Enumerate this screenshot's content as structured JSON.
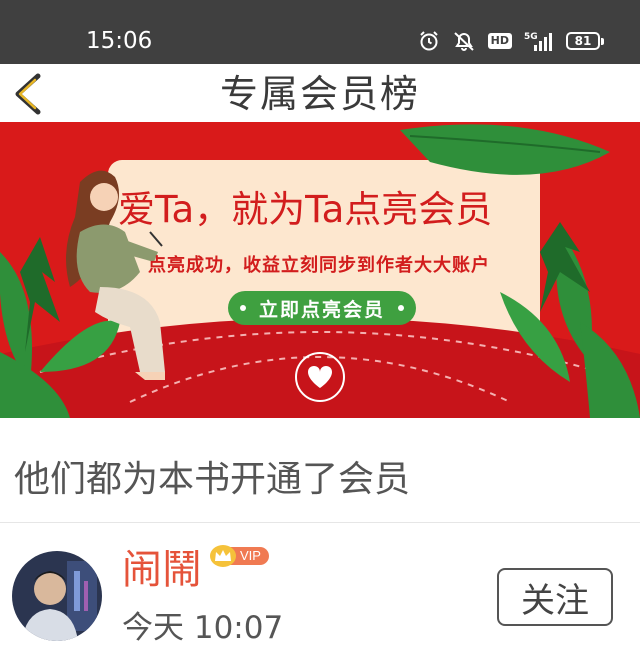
{
  "status_bar": {
    "time": "15:06",
    "hd_label": "HD",
    "network_label": "5G",
    "battery": "81",
    "icons": [
      "alarm-icon",
      "mute-icon",
      "hd-icon",
      "signal-5g-icon",
      "battery-icon"
    ]
  },
  "nav": {
    "back_icon": "chevron-left-icon",
    "title": "专属会员榜"
  },
  "banner": {
    "headline": "爱Ta，就为Ta点亮会员",
    "subtitle": "点亮成功，收益立刻同步到作者大大账户",
    "cta_label": "立即点亮会员",
    "colors": {
      "background": "#d91a1a",
      "card": "#fde7cf",
      "cta": "#3fa040",
      "leaf": "#2f8f3a"
    }
  },
  "section": {
    "title": "他们都为本书开通了会员"
  },
  "members": [
    {
      "name": "闹鬧",
      "badge": "VIP",
      "time": "今天 10:07",
      "follow_label": "关注"
    }
  ],
  "colors": {
    "accent": "#e5533a",
    "vip_badge": "#f07a52",
    "status_bar": "#404040"
  }
}
